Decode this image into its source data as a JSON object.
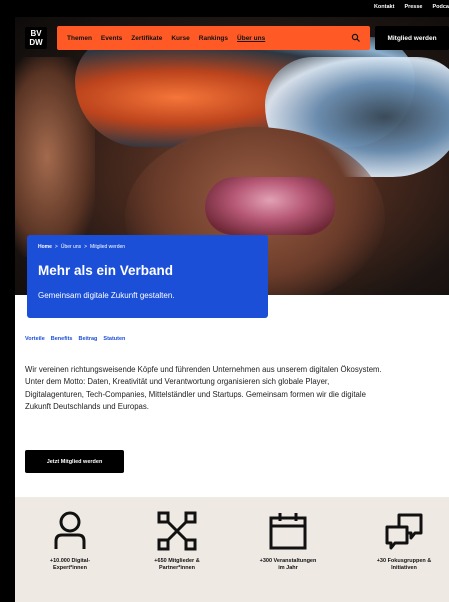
{
  "utility_nav": {
    "links": [
      "Kontakt",
      "Presse",
      "Podca"
    ]
  },
  "header": {
    "logo_text": "BV DW",
    "nav": [
      "Themen",
      "Events",
      "Zertifikate",
      "Kurse",
      "Rankings",
      "Über uns"
    ],
    "active_nav": "Über uns",
    "member_button": "Mitglied werden"
  },
  "breadcrumb": {
    "items": [
      "Home",
      "Über uns",
      "Mitglied werden"
    ],
    "separator": ">"
  },
  "hero": {
    "title": "Mehr als ein Verband",
    "subtitle": "Gemeinsam digitale Zukunft gestalten."
  },
  "anchors": [
    "Vorteile",
    "Benefits",
    "Beitrag",
    "Statuten"
  ],
  "intro": "Wir vereinen richtungsweisende Köpfe und führenden Unternehmen aus unserem digitalen Ökosystem. Unter dem Motto: Daten, Kreativität und Verantwortung organisieren sich globale Player, Digitalagenturen, Tech-Companies, Mittelständler und Startups. Gemeinsam formen wir die digitale Zukunft Deutschlands und Europas.",
  "cta": "Jetzt Mitglied werden",
  "stats": [
    {
      "icon": "person-icon",
      "label": "+10.000 Digital-\nExpert*innen"
    },
    {
      "icon": "network-icon",
      "label": "+650 Mitglieder &\nPartner*innen"
    },
    {
      "icon": "calendar-icon",
      "label": "+300 Veranstaltungen\nim Jahr"
    },
    {
      "icon": "chat-icon",
      "label": "+30 Fokusgruppen &\nInitiativen"
    }
  ],
  "colors": {
    "accent_orange": "#ff5a26",
    "brand_blue": "#1b4fd8",
    "stats_bg": "#efe9e3"
  }
}
